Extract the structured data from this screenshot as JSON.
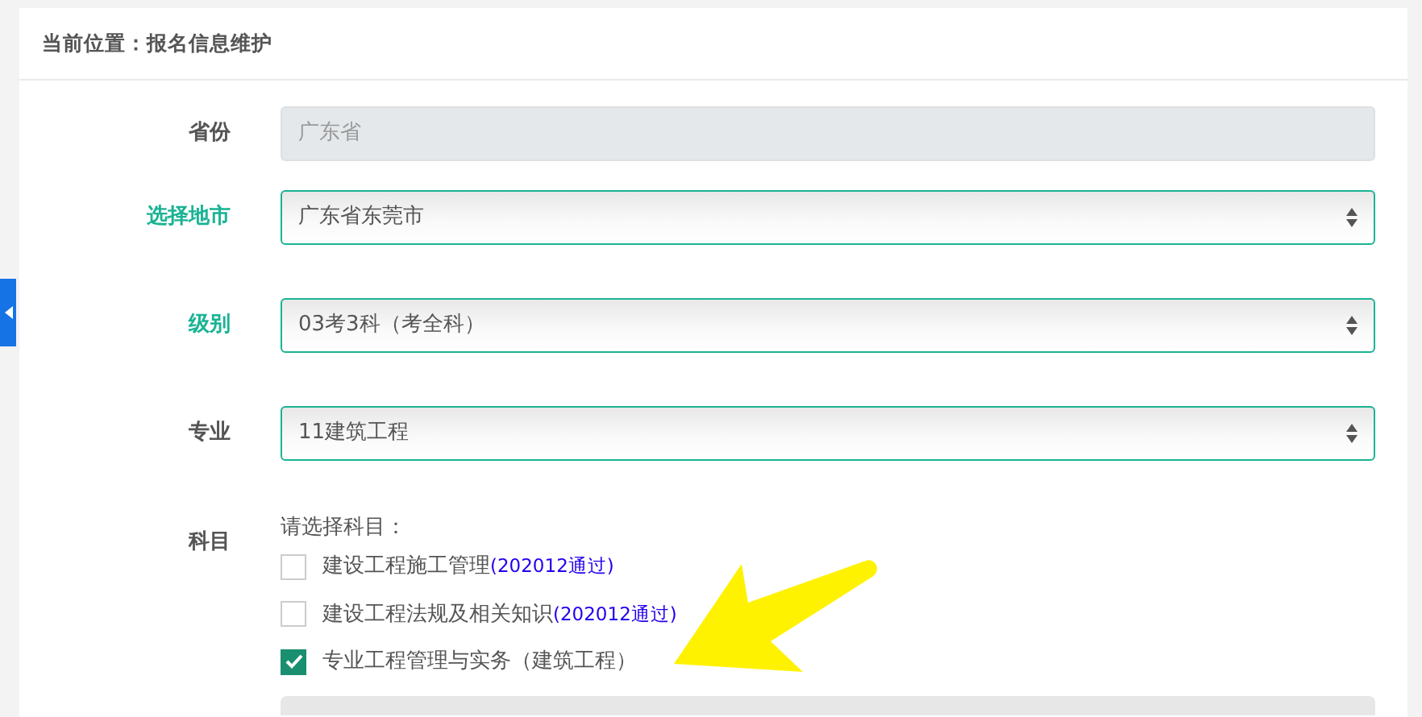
{
  "breadcrumb": "当前位置：报名信息维护",
  "fields": [
    {
      "label": "省份",
      "kind": "input",
      "disabled": true,
      "highlighted": false,
      "value": "广东省"
    },
    {
      "label": "选择地市",
      "kind": "select",
      "disabled": false,
      "highlighted": true,
      "value": "广东省东莞市"
    },
    {
      "label": "级别",
      "kind": "select",
      "disabled": false,
      "highlighted": true,
      "value": "03考3科（考全科）"
    },
    {
      "label": "专业",
      "kind": "select",
      "disabled": false,
      "highlighted": false,
      "value": "11建筑工程"
    }
  ],
  "subjects": {
    "label": "科目",
    "prompt": "请选择科目：",
    "items": [
      {
        "name": "建设工程施工管理",
        "note": "(202012通过)",
        "checked": false
      },
      {
        "name": "建设工程法规及相关知识",
        "note": "(202012通过)",
        "checked": false
      },
      {
        "name": "专业工程管理与实务（建筑工程）",
        "checked": true
      }
    ]
  }
}
